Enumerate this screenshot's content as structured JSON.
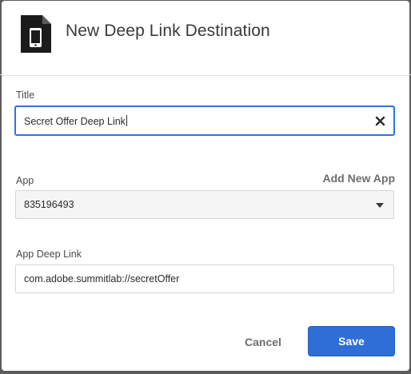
{
  "dialog": {
    "title": "New Deep Link Destination",
    "icon": "mobile-document-icon"
  },
  "fields": {
    "title": {
      "label": "Title",
      "value": "Secret Offer Deep Link"
    },
    "app": {
      "label": "App",
      "value": "835196493",
      "add_link": "Add New App"
    },
    "deep_link": {
      "label": "App Deep Link",
      "value": "com.adobe.summitlab://secretOffer"
    }
  },
  "actions": {
    "cancel_label": "Cancel",
    "save_label": "Save"
  },
  "colors": {
    "primary": "#2d6fd6",
    "focus": "#2d74e0",
    "overlay": "#5c5c5c"
  }
}
